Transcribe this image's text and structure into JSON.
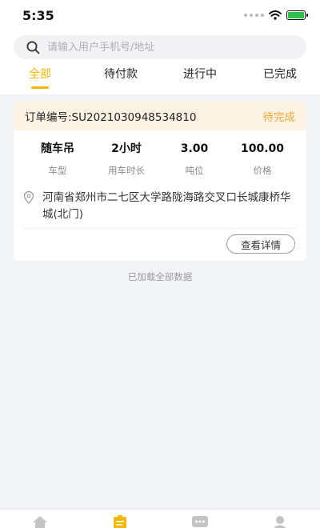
{
  "status_bar": {
    "time": "5:35"
  },
  "search": {
    "placeholder": "请输入用户手机号/地址"
  },
  "tabs": [
    {
      "label": "全部",
      "active": true
    },
    {
      "label": "待付款",
      "active": false
    },
    {
      "label": "进行中",
      "active": false
    },
    {
      "label": "已完成",
      "active": false
    }
  ],
  "order": {
    "order_no": "订单编号:SU2021030948534810",
    "status": "待完成",
    "stats": [
      {
        "value": "随车吊",
        "label": "车型"
      },
      {
        "value": "2小时",
        "label": "用车时长"
      },
      {
        "value": "3.00",
        "label": "吨位"
      },
      {
        "value": "100.00",
        "label": "价格"
      }
    ],
    "address": "河南省郑州市二七区大学路陇海路交叉口长城康桥华城(北门)",
    "detail_button": "查看详情"
  },
  "footer_note": "已加载全部数据",
  "colors": {
    "accent": "#f5b700",
    "status": "#f0a93a",
    "header_bg": "#fdf3e5"
  },
  "bottom_nav": {
    "icons": [
      "home-icon",
      "orders-icon",
      "message-icon",
      "profile-icon"
    ]
  }
}
